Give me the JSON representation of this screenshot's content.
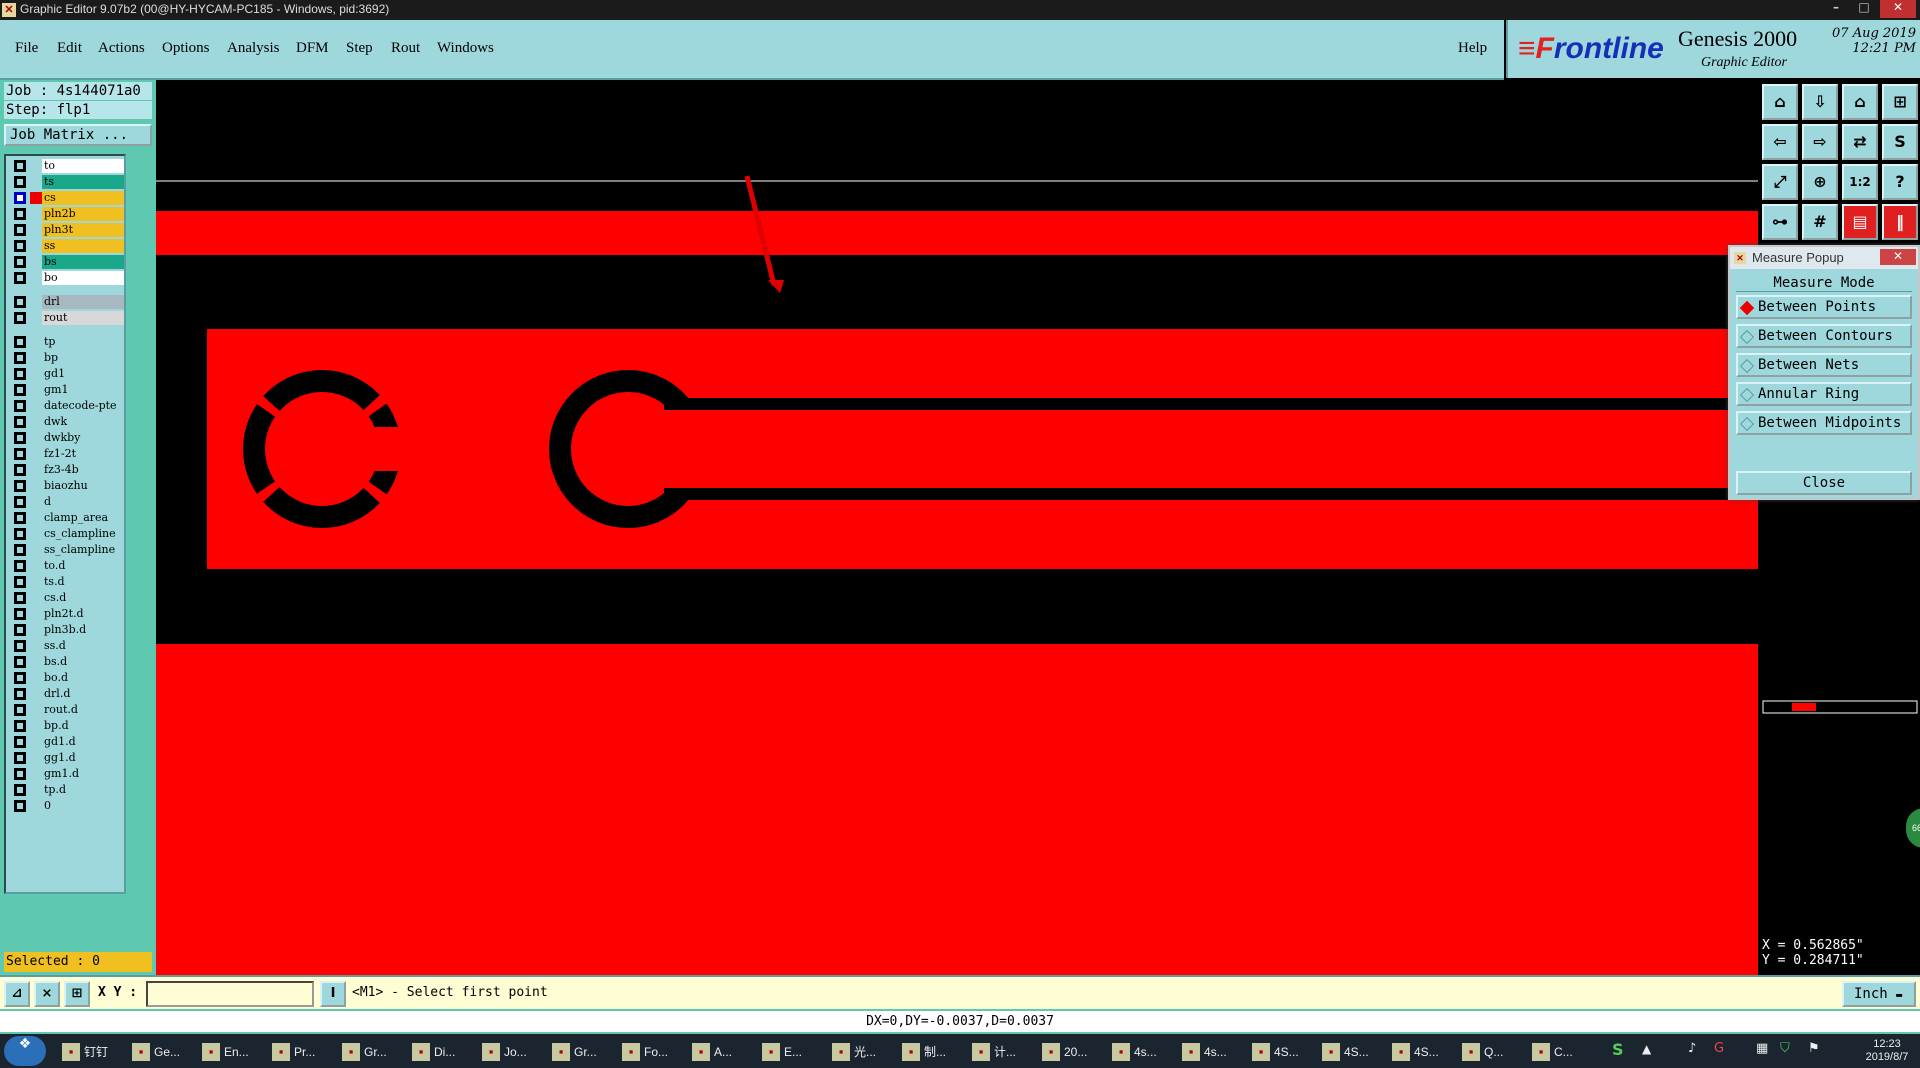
{
  "window": {
    "title": "Graphic Editor 9.07b2 (00@HY-HYCAM-PC185 - Windows, pid:3692)",
    "icon": "x-icon"
  },
  "menu": [
    "File",
    "Edit",
    "Actions",
    "Options",
    "Analysis",
    "DFM",
    "Step",
    "Rout",
    "Windows"
  ],
  "help": "Help",
  "logo": {
    "brand_prefix": "≡F",
    "brand_rest": "rontline",
    "product": "Genesis 2000",
    "subtitle": "Graphic Editor",
    "date": "07 Aug 2019",
    "time": "12:21 PM"
  },
  "job": {
    "job_line": "Job : 4s144071a0",
    "step_line": "Step: flp1",
    "matrix_button": "Job Matrix ..."
  },
  "layers": [
    {
      "name": "to",
      "color": "#ffffff",
      "selected": false,
      "marker": false
    },
    {
      "name": "ts",
      "color": "#1aa88a",
      "selected": false,
      "marker": false
    },
    {
      "name": "cs",
      "color": "#f0c020",
      "selected": true,
      "marker": true
    },
    {
      "name": "pln2b",
      "color": "#f0c020",
      "selected": false,
      "marker": false
    },
    {
      "name": "pln3t",
      "color": "#f0c020",
      "selected": false,
      "marker": false
    },
    {
      "name": "ss",
      "color": "#f0c020",
      "selected": false,
      "marker": false
    },
    {
      "name": "bs",
      "color": "#1aa88a",
      "selected": false,
      "marker": false
    },
    {
      "name": "bo",
      "color": "#ffffff",
      "selected": false,
      "marker": false
    },
    {
      "name": "drl",
      "color": "#a8b8c0",
      "selected": false,
      "marker": false
    },
    {
      "name": "rout",
      "color": "#d8d8d8",
      "selected": false,
      "marker": false
    },
    {
      "name": "tp",
      "color": "#9ed8dc",
      "selected": false,
      "marker": false
    },
    {
      "name": "bp",
      "color": "#9ed8dc",
      "selected": false,
      "marker": false
    },
    {
      "name": "gd1",
      "color": "#9ed8dc",
      "selected": false,
      "marker": false
    },
    {
      "name": "gm1",
      "color": "#9ed8dc",
      "selected": false,
      "marker": false
    },
    {
      "name": "datecode-pte",
      "color": "#9ed8dc",
      "selected": false,
      "marker": false
    },
    {
      "name": "dwk",
      "color": "#9ed8dc",
      "selected": false,
      "marker": false
    },
    {
      "name": "dwkby",
      "color": "#9ed8dc",
      "selected": false,
      "marker": false
    },
    {
      "name": "fz1-2t",
      "color": "#9ed8dc",
      "selected": false,
      "marker": false
    },
    {
      "name": "fz3-4b",
      "color": "#9ed8dc",
      "selected": false,
      "marker": false
    },
    {
      "name": "biaozhu",
      "color": "#9ed8dc",
      "selected": false,
      "marker": false
    },
    {
      "name": "d",
      "color": "#9ed8dc",
      "selected": false,
      "marker": false
    },
    {
      "name": "clamp_area",
      "color": "#9ed8dc",
      "selected": false,
      "marker": false
    },
    {
      "name": "cs_clampline",
      "color": "#9ed8dc",
      "selected": false,
      "marker": false
    },
    {
      "name": "ss_clampline",
      "color": "#9ed8dc",
      "selected": false,
      "marker": false
    },
    {
      "name": "to.d",
      "color": "#9ed8dc",
      "selected": false,
      "marker": false
    },
    {
      "name": "ts.d",
      "color": "#9ed8dc",
      "selected": false,
      "marker": false
    },
    {
      "name": "cs.d",
      "color": "#9ed8dc",
      "selected": false,
      "marker": false
    },
    {
      "name": "pln2t.d",
      "color": "#9ed8dc",
      "selected": false,
      "marker": false
    },
    {
      "name": "pln3b.d",
      "color": "#9ed8dc",
      "selected": false,
      "marker": false
    },
    {
      "name": "ss.d",
      "color": "#9ed8dc",
      "selected": false,
      "marker": false
    },
    {
      "name": "bs.d",
      "color": "#9ed8dc",
      "selected": false,
      "marker": false
    },
    {
      "name": "bo.d",
      "color": "#9ed8dc",
      "selected": false,
      "marker": false
    },
    {
      "name": "drl.d",
      "color": "#9ed8dc",
      "selected": false,
      "marker": false
    },
    {
      "name": "rout.d",
      "color": "#9ed8dc",
      "selected": false,
      "marker": false
    },
    {
      "name": "bp.d",
      "color": "#9ed8dc",
      "selected": false,
      "marker": false
    },
    {
      "name": "gd1.d",
      "color": "#9ed8dc",
      "selected": false,
      "marker": false
    },
    {
      "name": "gg1.d",
      "color": "#9ed8dc",
      "selected": false,
      "marker": false
    },
    {
      "name": "gm1.d",
      "color": "#9ed8dc",
      "selected": false,
      "marker": false
    },
    {
      "name": "tp.d",
      "color": "#9ed8dc",
      "selected": false,
      "marker": false
    },
    {
      "name": "0",
      "color": "#9ed8dc",
      "selected": false,
      "marker": false
    }
  ],
  "selected_count": "Selected : 0",
  "tools": [
    {
      "icon": "zoom-home-icon",
      "glyph": "⌂"
    },
    {
      "icon": "zoom-down-icon",
      "glyph": "⇩"
    },
    {
      "icon": "home-icon",
      "glyph": "⌂"
    },
    {
      "icon": "window-icon",
      "glyph": "⊞"
    },
    {
      "icon": "pan-left-icon",
      "glyph": "⇦"
    },
    {
      "icon": "pan-right-icon",
      "glyph": "⇨"
    },
    {
      "icon": "mirror-icon",
      "glyph": "⇄"
    },
    {
      "icon": "snap-icon",
      "glyph": "S"
    },
    {
      "icon": "zoom-fit-icon",
      "glyph": "⤢"
    },
    {
      "icon": "center-icon",
      "glyph": "⊕"
    },
    {
      "icon": "scale-icon",
      "glyph": "1:2"
    },
    {
      "icon": "help-icon",
      "glyph": "?"
    },
    {
      "icon": "measure-icon",
      "glyph": "⊶"
    },
    {
      "icon": "grid-icon",
      "glyph": "#"
    },
    {
      "icon": "layers-icon",
      "glyph": "▤"
    },
    {
      "icon": "slider-icon",
      "glyph": "‖"
    }
  ],
  "measure_popup": {
    "title": "Measure Popup",
    "mode_label": "Measure Mode",
    "options": [
      {
        "label": "Between Points",
        "active": true
      },
      {
        "label": "Between Contours",
        "active": false
      },
      {
        "label": "Between Nets",
        "active": false
      },
      {
        "label": "Annular Ring",
        "active": false
      },
      {
        "label": "Between Midpoints",
        "active": false
      }
    ],
    "close": "Close"
  },
  "coordinates": {
    "x": "X = 0.562865\"",
    "y": "Y = 0.284711\""
  },
  "command": {
    "xy_label": "X Y :",
    "xy_value": "",
    "prompt": "<M1> - Select first point",
    "unit": "Inch"
  },
  "status": "DX=0,DY=-0.0037,D=0.0037",
  "taskbar": {
    "items": [
      {
        "label": "钉钉",
        "icon": "dingtalk-icon"
      },
      {
        "label": "Ge...",
        "icon": "genesis-icon"
      },
      {
        "label": "En...",
        "icon": "x-icon"
      },
      {
        "label": "Pr...",
        "icon": "x-icon"
      },
      {
        "label": "Gr...",
        "icon": "x-icon"
      },
      {
        "label": "Di...",
        "icon": "x-icon"
      },
      {
        "label": "Jo...",
        "icon": "x-icon"
      },
      {
        "label": "Gr...",
        "icon": "x-icon"
      },
      {
        "label": "Fo...",
        "icon": "browser-icon"
      },
      {
        "label": "A...",
        "icon": "disk-icon"
      },
      {
        "label": "E...",
        "icon": "f-icon"
      },
      {
        "label": "光...",
        "icon": "sun-icon"
      },
      {
        "label": "制...",
        "icon": "doc-icon"
      },
      {
        "label": "计...",
        "icon": "calc-icon"
      },
      {
        "label": "20...",
        "icon": "word-icon"
      },
      {
        "label": "4s...",
        "icon": "word-icon"
      },
      {
        "label": "4s...",
        "icon": "folder-icon"
      },
      {
        "label": "4S...",
        "icon": "excel-icon"
      },
      {
        "label": "4S...",
        "icon": "excel-icon"
      },
      {
        "label": "4S...",
        "icon": "excel-icon"
      },
      {
        "label": "Q...",
        "icon": "excel-icon"
      },
      {
        "label": "C...",
        "icon": "cam-icon"
      }
    ],
    "clock_time": "12:23",
    "clock_date": "2019/8/7"
  },
  "colors": {
    "copper": "#ff0000",
    "background": "#000000",
    "panel": "#9ed8dc"
  }
}
